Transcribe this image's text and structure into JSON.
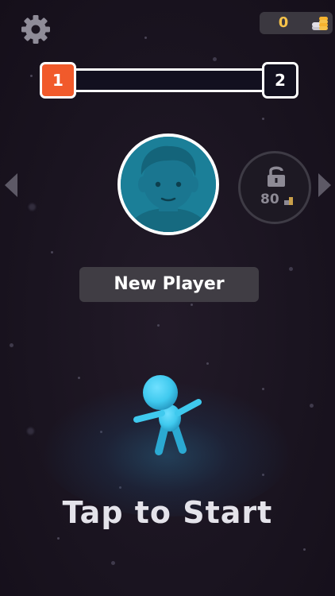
{
  "hud": {
    "settings_icon": "gear-icon",
    "coins": "0",
    "coin_icon": "coin-stack-icon"
  },
  "level": {
    "current": "1",
    "next": "2",
    "progress": 0,
    "current_color": "#f15a2b"
  },
  "avatars": {
    "selected_icon": "player-face-icon",
    "locked_icon": "lock-icon",
    "locked_cost": "80",
    "prev_icon": "chevron-left-icon",
    "next_icon": "chevron-right-icon"
  },
  "player": {
    "name": "New Player"
  },
  "start": {
    "label": "Tap to Start"
  },
  "colors": {
    "character": "#3fc9ee",
    "background": "#1b1520",
    "coin": "#f6c24a"
  }
}
